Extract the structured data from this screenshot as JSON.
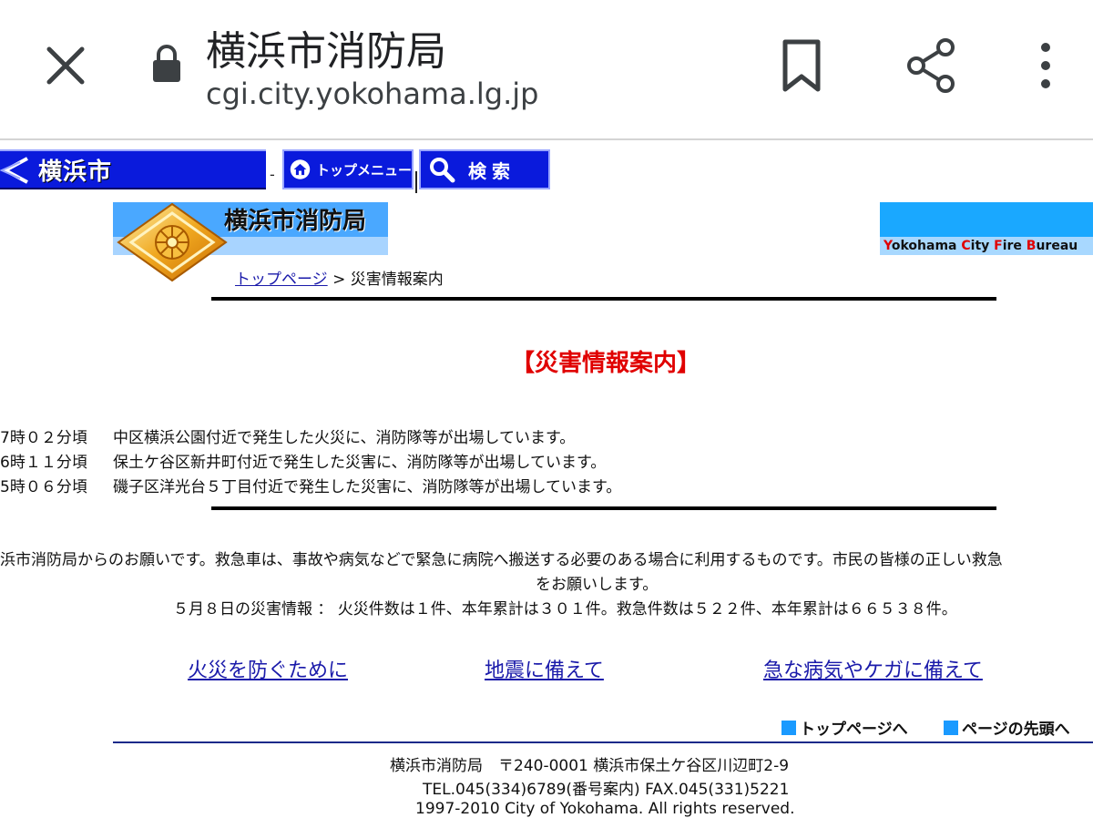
{
  "browser": {
    "title": "横浜市消防局",
    "url": "cgi.city.yokohama.lg.jp"
  },
  "nav": {
    "city_label": "横浜市",
    "separator": "-",
    "top_menu_label": "トップメニュー",
    "search_label": "検索"
  },
  "banner": {
    "bureau_name": "横浜市消防局",
    "bureau_en_parts": [
      "Y",
      "okohama ",
      "C",
      "ity ",
      "F",
      "ire ",
      "B",
      "ureau"
    ]
  },
  "breadcrumb": {
    "home_link": "トップページ",
    "separator": " > ",
    "current": "災害情報案内"
  },
  "heading": "【災害情報案内】",
  "reports": [
    {
      "time": "7時０２分頃",
      "text": "中区横浜公園付近で発生した火災に、消防隊等が出場しています。"
    },
    {
      "time": "6時１１分頃",
      "text": "保土ケ谷区新井町付近で発生した災害に、消防隊等が出場しています。"
    },
    {
      "time": "5時０６分頃",
      "text": "磯子区洋光台５丁目付近で発生した災害に、消防隊等が出場しています。"
    }
  ],
  "notice": {
    "line1": "浜市消防局からのお願いです。救急車は、事故や病気などで緊急に病院へ搬送する必要のある場合に利用するものです。市民の皆様の正しい救急",
    "line2": "をお願いします。"
  },
  "daily_summary": "５月８日の災害情報 ： 火災件数は１件、本年累計は３０１件。救急件数は５２２件、本年累計は６６５３８件。",
  "links": {
    "fire": "火災を防ぐために",
    "quake": "地震に備えて",
    "health": "急な病気やケガに備えて"
  },
  "footer_nav": {
    "top": "トップページへ",
    "page_top": "ページの先頭へ"
  },
  "footer": {
    "line1": "横浜市消防局　〒240-0001 横浜市保土ケ谷区川辺町2-9",
    "line2": "TEL.045(334)6789(番号案内) FAX.045(331)5221",
    "line3": "1997-2010 City of Yokohama. All rights reserved."
  }
}
